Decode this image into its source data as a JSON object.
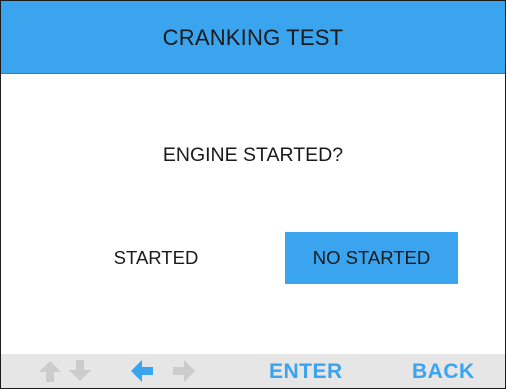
{
  "header": {
    "title": "CRANKING TEST"
  },
  "prompt": {
    "question": "ENGINE STARTED?"
  },
  "options": [
    {
      "label": "STARTED",
      "selected": false
    },
    {
      "label": "NO STARTED",
      "selected": true
    }
  ],
  "footer": {
    "icons": [
      "arrow-up-icon",
      "arrow-down-icon",
      "arrow-left-icon",
      "arrow-right-icon"
    ],
    "enter_label": "ENTER",
    "back_label": "BACK"
  },
  "colors": {
    "accent": "#3aa4ef",
    "arrow_inactive": "#cccccc",
    "footer_bg": "#e6e6e6"
  }
}
